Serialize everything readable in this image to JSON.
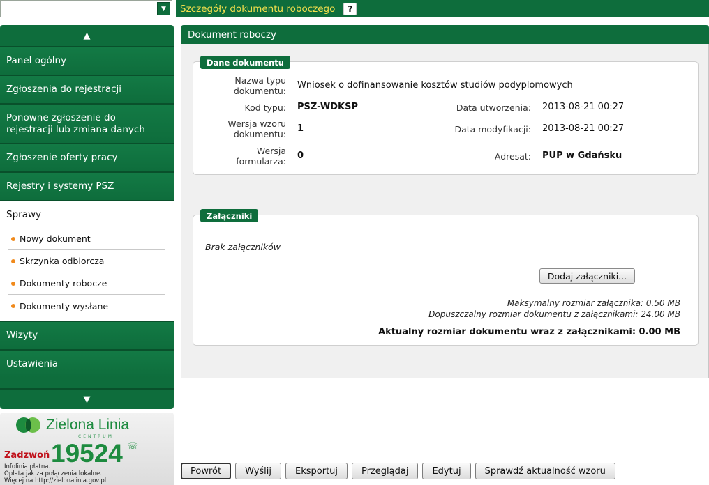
{
  "combo": {
    "value": ""
  },
  "topbar": {
    "title": "Szczegóły dokumentu roboczego",
    "help": "?"
  },
  "nav": {
    "up_arrow": "▲",
    "down_arrow": "▼",
    "items_top": [
      {
        "label": "Panel ogólny"
      },
      {
        "label": "Zgłoszenia do rejestracji"
      },
      {
        "label": "Ponowne zgłoszenie do rejestracji lub zmiana danych"
      },
      {
        "label": "Zgłoszenie oferty pracy"
      },
      {
        "label": "Rejestry i systemy PSZ"
      }
    ],
    "section": {
      "title": "Sprawy",
      "items": [
        {
          "label": "Nowy dokument"
        },
        {
          "label": "Skrzynka odbiorcza"
        },
        {
          "label": "Dokumenty robocze"
        },
        {
          "label": "Dokumenty wysłane"
        }
      ]
    },
    "items_bottom": [
      {
        "label": "Wizyty"
      },
      {
        "label": "Ustawienia"
      }
    ]
  },
  "promo": {
    "name": "Zielona Linia",
    "centrum": "CENTRUM",
    "call": "Zadzwoń",
    "number": "19524",
    "line1": "Infolinia płatna.",
    "line2": "Opłata jak za połączenia lokalne.",
    "line3": "Więcej na http://zielonalinia.gov.pl"
  },
  "panel": {
    "title": "Dokument roboczy"
  },
  "document": {
    "legend": "Dane dokumentu",
    "type_name_label": "Nazwa typu dokumentu:",
    "type_name": "Wniosek o dofinansowanie kosztów studiów podyplomowych",
    "type_code_label": "Kod typu:",
    "type_code": "PSZ-WDKSP",
    "created_label": "Data utworzenia:",
    "created": "2013-08-21 00:27",
    "template_version_label": "Wersja wzoru dokumentu:",
    "template_version": "1",
    "modified_label": "Data modyfikacji:",
    "modified": "2013-08-21 00:27",
    "form_version_label": "Wersja formularza:",
    "form_version": "0",
    "addressee_label": "Adresat:",
    "addressee": "PUP w Gdańsku"
  },
  "attachments": {
    "legend": "Załączniki",
    "empty": "Brak załączników",
    "add_button": "Dodaj załączniki...",
    "max_attachment": "Maksymalny rozmiar załącznika: 0.50 MB",
    "max_document": "Dopuszczalny rozmiar dokumentu z załącznikami: 24.00 MB",
    "current_size": "Aktualny rozmiar dokumentu wraz z załącznikami: 0.00 MB"
  },
  "toolbar": {
    "back": "Powrót",
    "send": "Wyślij",
    "export": "Eksportuj",
    "view": "Przeglądaj",
    "edit": "Edytuj",
    "check": "Sprawdź aktualność wzoru"
  },
  "colors": {
    "brand_green": "#0e6d3c",
    "title_yellow": "#f4e04d",
    "bullet_orange": "#f08a1c"
  }
}
